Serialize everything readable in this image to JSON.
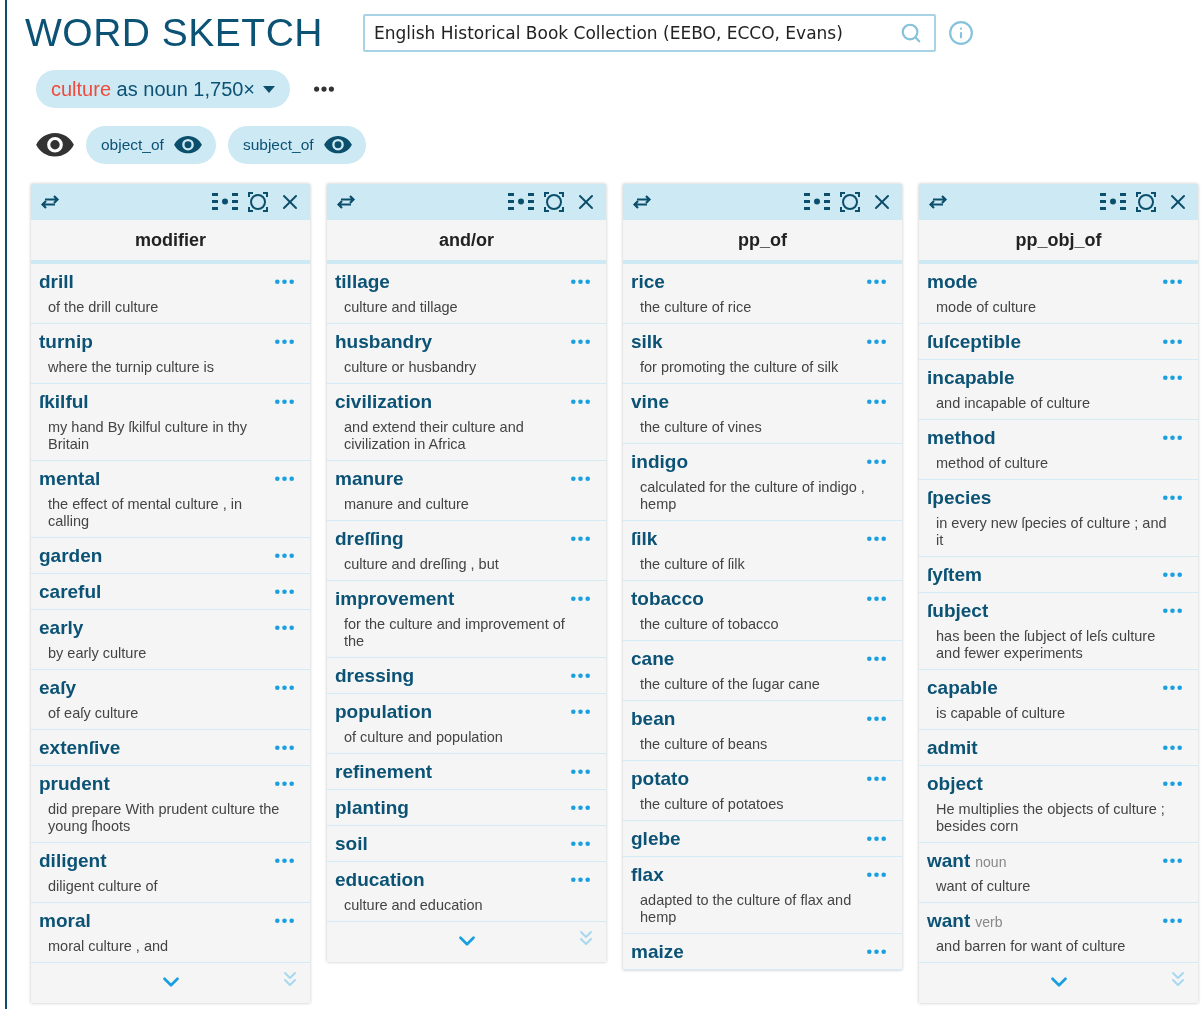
{
  "title": "WORD SKETCH",
  "corpus": "English Historical Book Collection (EEBO, ECCO, Evans)",
  "lemma_chip": {
    "lemma": "culture",
    "text": "as noun 1,750×"
  },
  "filters": [
    {
      "label": "object_of"
    },
    {
      "label": "subject_of"
    }
  ],
  "columns": [
    {
      "title": "modifier",
      "footer": true,
      "rows": [
        {
          "word": "drill",
          "example": "of the drill culture"
        },
        {
          "word": "turnip",
          "example": "where the turnip culture is"
        },
        {
          "word": "ſkilful",
          "example": "my hand By ſkilful culture in thy Britain"
        },
        {
          "word": "mental",
          "example": "the effect of mental culture , in calling"
        },
        {
          "word": "garden"
        },
        {
          "word": "careful"
        },
        {
          "word": "early",
          "example": "by early culture"
        },
        {
          "word": "eaſy",
          "example": "of eaſy culture"
        },
        {
          "word": "extenſive"
        },
        {
          "word": "prudent",
          "example": "did prepare With prudent culture the young ſhoots"
        },
        {
          "word": "diligent",
          "example": "diligent culture of"
        },
        {
          "word": "moral",
          "example": "moral culture , and"
        }
      ]
    },
    {
      "title": "and/or",
      "footer": true,
      "rows": [
        {
          "word": "tillage",
          "example": "culture and tillage"
        },
        {
          "word": "husbandry",
          "example": "culture or husbandry"
        },
        {
          "word": "civilization",
          "example": "and extend their culture and civilization in Africa"
        },
        {
          "word": "manure",
          "example": "manure and culture"
        },
        {
          "word": "dreſſing",
          "example": "culture and dreſſing , but"
        },
        {
          "word": "improvement",
          "example": "for the culture and improvement of the"
        },
        {
          "word": "dressing"
        },
        {
          "word": "population",
          "example": "of culture and population"
        },
        {
          "word": "refinement"
        },
        {
          "word": "planting"
        },
        {
          "word": "soil"
        },
        {
          "word": "education",
          "example": "culture and education"
        }
      ]
    },
    {
      "title": "pp_of",
      "footer": false,
      "rows": [
        {
          "word": "rice",
          "example": "the culture of rice"
        },
        {
          "word": "silk",
          "example": "for promoting the culture of silk"
        },
        {
          "word": "vine",
          "example": "the culture of vines"
        },
        {
          "word": "indigo",
          "example": "calculated for the culture of indigo , hemp"
        },
        {
          "word": "ſilk",
          "example": "the culture of ſilk"
        },
        {
          "word": "tobacco",
          "example": "the culture of tobacco"
        },
        {
          "word": "cane",
          "example": "the culture of the ſugar cane"
        },
        {
          "word": "bean",
          "example": "the culture of beans"
        },
        {
          "word": "potato",
          "example": "the culture of potatoes"
        },
        {
          "word": "glebe"
        },
        {
          "word": "flax",
          "example": "adapted to the culture of flax and hemp"
        },
        {
          "word": "maize"
        }
      ]
    },
    {
      "title": "pp_obj_of",
      "footer": true,
      "rows": [
        {
          "word": "mode",
          "example": "mode of culture"
        },
        {
          "word": "ſuſceptible"
        },
        {
          "word": "incapable",
          "example": "and incapable of culture"
        },
        {
          "word": "method",
          "example": "method of culture"
        },
        {
          "word": "ſpecies",
          "example": "in every new ſpecies of culture ; and it"
        },
        {
          "word": "ſyſtem"
        },
        {
          "word": "ſubject",
          "example": "has been the ſubject of leſs culture and fewer experiments"
        },
        {
          "word": "capable",
          "example": "is capable of culture"
        },
        {
          "word": "admit"
        },
        {
          "word": "object",
          "example": "He multiplies the objects of culture ; besides corn"
        },
        {
          "word": "want",
          "pos": "noun",
          "example": "want of culture"
        },
        {
          "word": "want",
          "pos": "verb",
          "example": "and barren for want of culture"
        }
      ]
    }
  ]
}
